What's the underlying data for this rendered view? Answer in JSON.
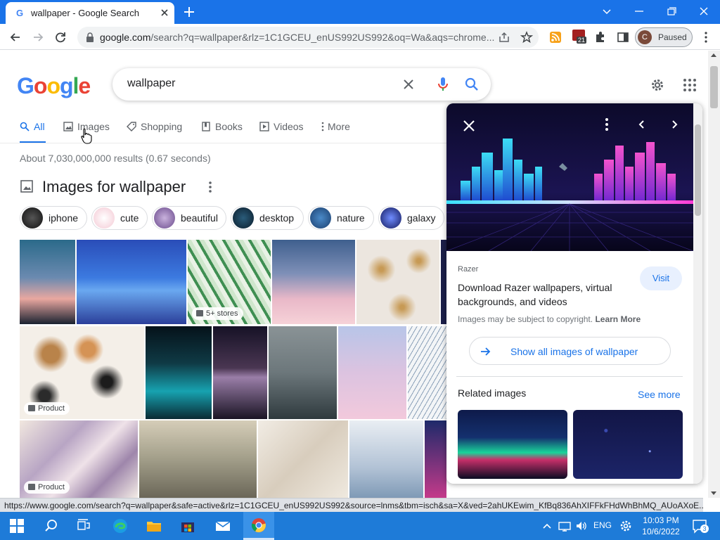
{
  "browser": {
    "tab_title": "wallpaper - Google Search",
    "url_main": "google.com",
    "url_rest": "/search?q=wallpaper&rlz=1C1GCEU_enUS992US992&oq=Wa&aqs=chrome...",
    "profile_initial": "C",
    "profile_status": "Paused",
    "extension_badge": "21"
  },
  "google": {
    "logo": [
      "G",
      "o",
      "o",
      "g",
      "l",
      "e"
    ],
    "logo_colors": [
      "#4285f4",
      "#ea4335",
      "#fbbc05",
      "#4285f4",
      "#34a853",
      "#ea4335"
    ],
    "query": "wallpaper"
  },
  "nav": {
    "tabs": [
      {
        "label": "All",
        "icon": "search-icon"
      },
      {
        "label": "Images",
        "icon": "image-icon"
      },
      {
        "label": "Shopping",
        "icon": "tag-icon"
      },
      {
        "label": "Books",
        "icon": "book-icon"
      },
      {
        "label": "Videos",
        "icon": "play-icon"
      },
      {
        "label": "More",
        "icon": "more-vert-icon"
      }
    ]
  },
  "results": {
    "stats": "About 7,030,000,000 results (0.67 seconds)"
  },
  "images_section": {
    "heading": "Images for wallpaper",
    "chips": [
      "iphone",
      "cute",
      "beautiful",
      "desktop",
      "nature",
      "galaxy"
    ],
    "badges": {
      "stores": "5+ stores",
      "product1": "Product",
      "product2": "Product"
    }
  },
  "panel": {
    "source": "Razer",
    "title": "Download Razer wallpapers, virtual backgrounds, and videos",
    "visit": "Visit",
    "copyright": "Images may be subject to copyright.",
    "learn_more": "Learn More",
    "show_all": "Show all images of wallpaper",
    "related": "Related images",
    "see_more": "See more"
  },
  "status_url": "https://www.google.com/search?q=wallpaper&safe=active&rlz=1C1GCEU_enUS992US992&source=lnms&tbm=isch&sa=X&ved=2ahUKEwim_KfBq836AhXIFFkFHdWhBhMQ_AUoAXoE...",
  "taskbar": {
    "lang": "ENG",
    "time": "10:03 PM",
    "date": "10/6/2022",
    "notifications": "3"
  },
  "colors": {
    "accent": "#1a73e8",
    "tabstrip": "#1a73e8",
    "taskbar": "#1e7bd8"
  }
}
